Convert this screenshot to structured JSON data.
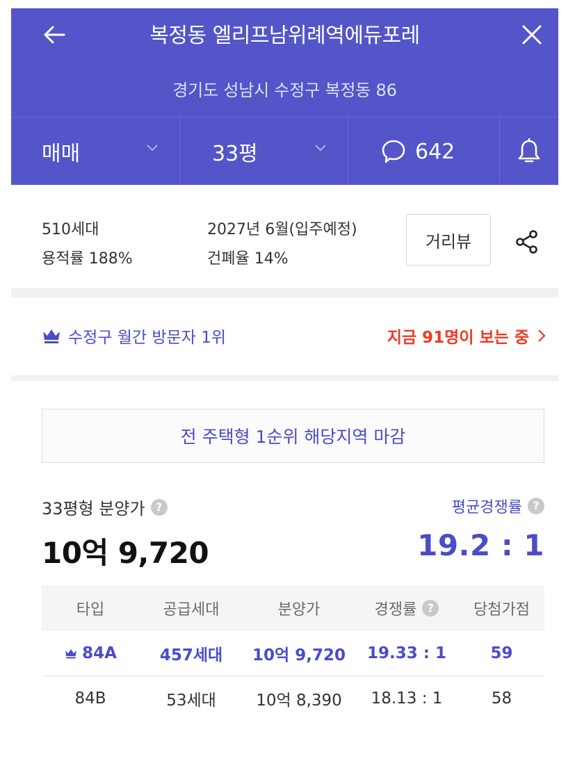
{
  "header": {
    "title": "복정동 엘리프남위례역에듀포레",
    "address": "경기도 성남시 수정구 복정동 86",
    "tabs": {
      "deal_type": "매매",
      "size": "33평",
      "comment_count": "642"
    },
    "icons": {
      "back": "arrow-left-icon",
      "close": "close-icon",
      "comment": "speech-bubble-icon",
      "bell": "bell-icon",
      "chevron": "chevron-down-icon"
    },
    "colors": {
      "background": "#5355c8",
      "text": "#ffffff"
    }
  },
  "info": {
    "households": "510세대",
    "floor_area_ratio": "용적률 188%",
    "move_in": "2027년 6월(입주예정)",
    "building_coverage": "건폐율 14%",
    "street_view_label": "거리뷰",
    "share_icon": "share-icon"
  },
  "ranking": {
    "label": "수정구 월간 방문자 1위",
    "crown_icon": "crown-icon",
    "viewers": "지금 91명이 보는 중",
    "viewers_color": "#ef3b24"
  },
  "notice": "전 주택형 1순위 해당지역 마감",
  "summary": {
    "price_label": "33평형 분양가",
    "price_value": "10억 9,720",
    "competition_label": "평균경쟁률",
    "competition_value": "19.2 : 1",
    "help_icon": "help-icon",
    "help_glyph": "?"
  },
  "table": {
    "headers": [
      "타입",
      "공급세대",
      "분양가",
      "경쟁률",
      "당첨가점"
    ],
    "rows": [
      {
        "type": "84A",
        "supply": "457세대",
        "price": "10억 9,720",
        "competition": "19.33 : 1",
        "score": "59",
        "highlight": true
      },
      {
        "type": "84B",
        "supply": "53세대",
        "price": "10억 8,390",
        "competition": "18.13 : 1",
        "score": "58",
        "highlight": false
      }
    ]
  },
  "accent_color": "#4a4cc8"
}
